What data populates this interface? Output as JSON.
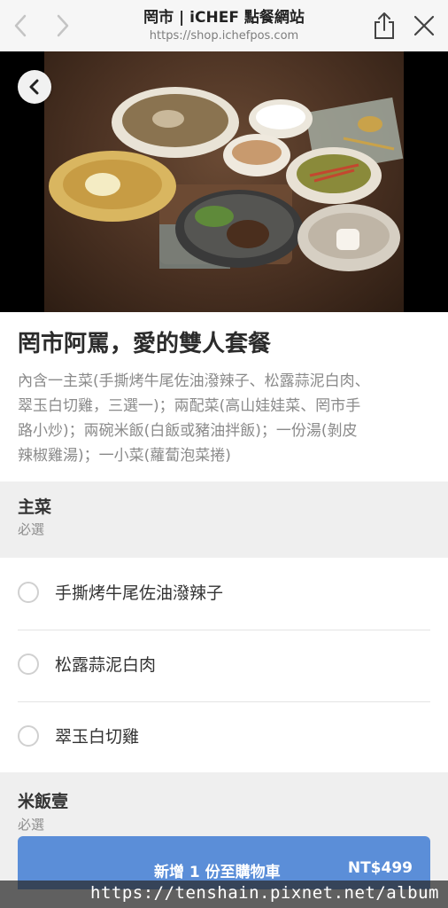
{
  "browser": {
    "title": "罔市 | iCHEF 點餐網站",
    "url": "https://shop.ichefpos.com"
  },
  "hero": {
    "image_icon": "food-photo",
    "back_icon": "chevron-left-icon"
  },
  "product": {
    "title": "罔市阿罵，愛的雙人套餐",
    "description_lines": [
      "內含一主菜(手撕烤牛尾佐油潑辣子、松露蒜泥白肉、",
      "翠玉白切雞，三選一)；兩配菜(高山娃娃菜、罔市手",
      "路小炒)；兩碗米飯(白飯或豬油拌飯)；一份湯(剝皮",
      "辣椒雞湯)；一小菜(蘿蔔泡菜捲)"
    ]
  },
  "sections": [
    {
      "title": "主菜",
      "subtitle": "必選",
      "options": [
        "手撕烤牛尾佐油潑辣子",
        "松露蒜泥白肉",
        "翠玉白切雞"
      ]
    },
    {
      "title": "米飯壹",
      "subtitle": "必選"
    }
  ],
  "cart": {
    "label": "新增 1 份至購物車",
    "price": "NT$499",
    "color": "#5b8ed8"
  },
  "watermark": "https://tenshain.pixnet.net/album"
}
